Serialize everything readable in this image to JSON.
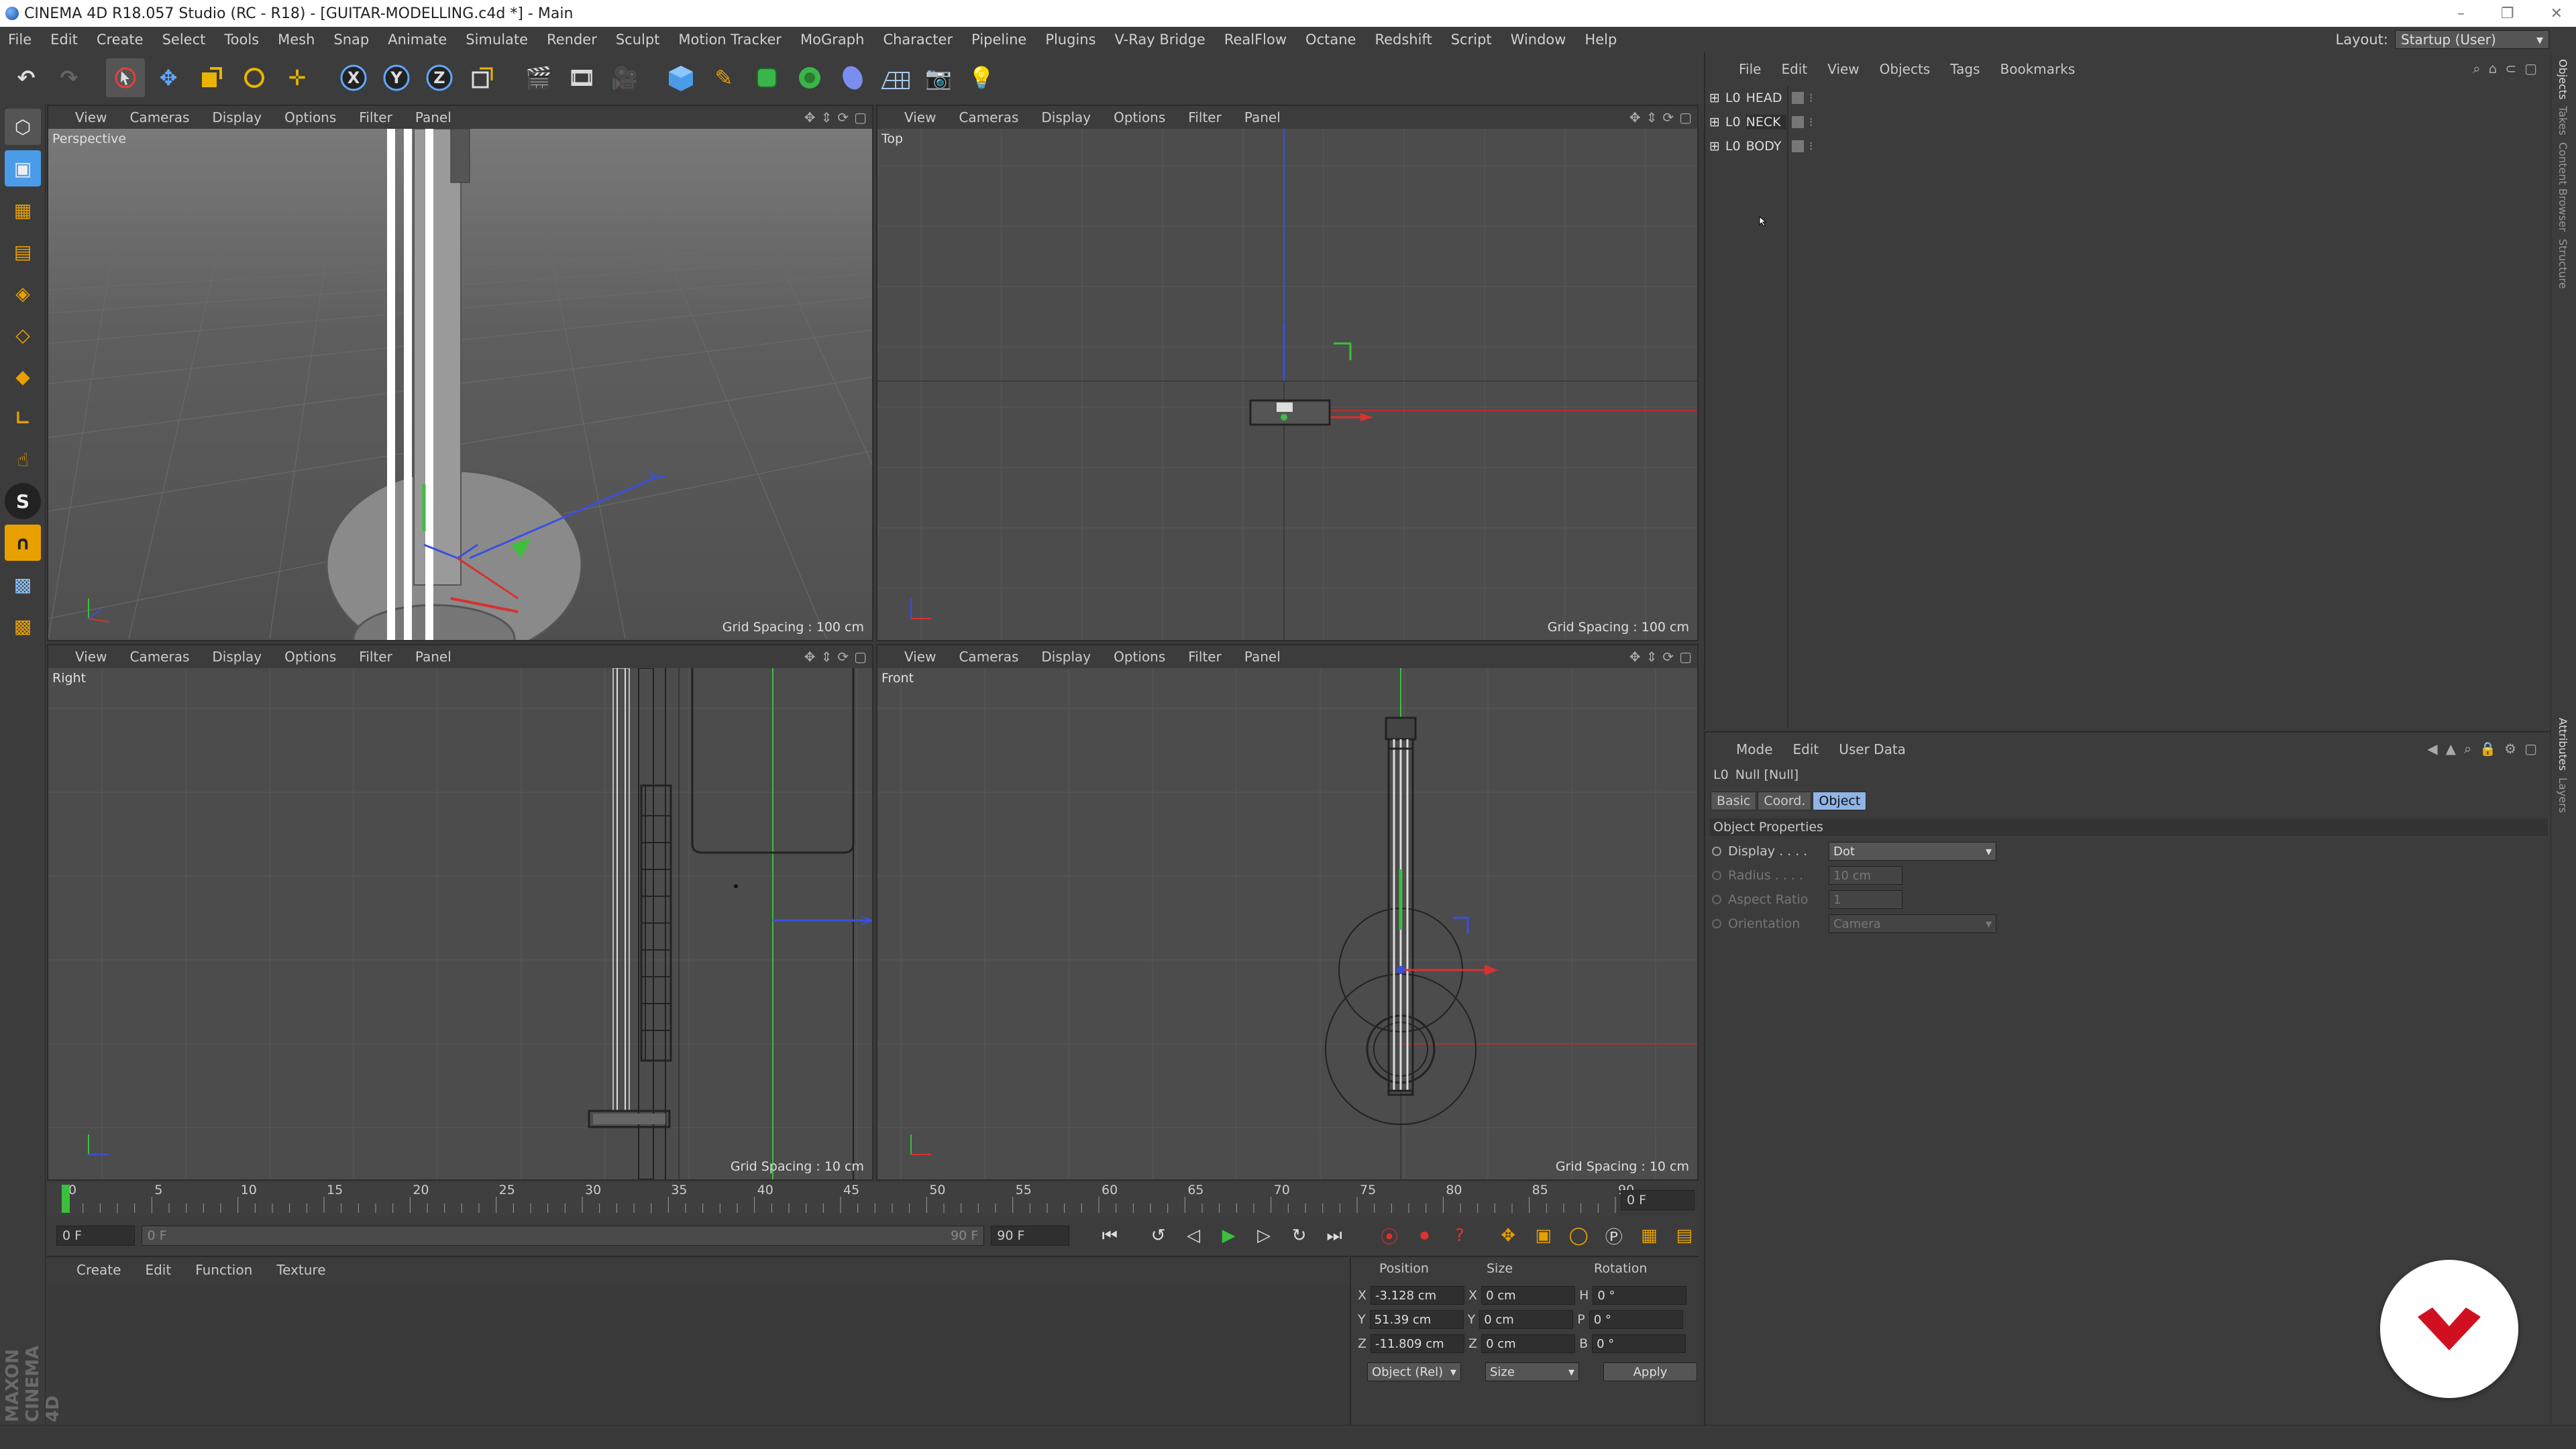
{
  "window": {
    "title": "CINEMA 4D R18.057 Studio (RC - R18) - [GUITAR-MODELLING.c4d *] - Main",
    "controls": [
      "–",
      "❐",
      "✕"
    ]
  },
  "menubar": {
    "items": [
      "File",
      "Edit",
      "Create",
      "Select",
      "Tools",
      "Mesh",
      "Snap",
      "Animate",
      "Simulate",
      "Render",
      "Sculpt",
      "Motion Tracker",
      "MoGraph",
      "Character",
      "Pipeline",
      "Plugins",
      "V-Ray Bridge",
      "RealFlow",
      "Octane",
      "Redshift",
      "Script",
      "Window",
      "Help"
    ],
    "layout_label": "Layout:",
    "layout_value": "Startup (User)"
  },
  "viewport_menu": [
    "View",
    "Cameras",
    "Display",
    "Options",
    "Filter",
    "Panel"
  ],
  "viewports": {
    "perspective": {
      "label": "Perspective",
      "grid": "Grid Spacing : 100 cm"
    },
    "top": {
      "label": "Top",
      "grid": "Grid Spacing : 100 cm"
    },
    "right": {
      "label": "Right",
      "grid": "Grid Spacing : 10 cm"
    },
    "front": {
      "label": "Front",
      "grid": "Grid Spacing : 10 cm"
    }
  },
  "timeline": {
    "ticks": [
      "0",
      "5",
      "10",
      "15",
      "20",
      "25",
      "30",
      "35",
      "40",
      "45",
      "50",
      "55",
      "60",
      "65",
      "70",
      "75",
      "80",
      "85",
      "90"
    ],
    "current_frame": "0 F",
    "start": "0 F",
    "range_start": "0 F",
    "range_end": "90 F",
    "end": "90 F"
  },
  "material_manager": {
    "menu": [
      "Create",
      "Edit",
      "Function",
      "Texture"
    ]
  },
  "coordinates": {
    "headers": [
      "Position",
      "Size",
      "Rotation"
    ],
    "rows": [
      {
        "axis": "X",
        "pos": "-3.128 cm",
        "size_axis": "X",
        "size": "0 cm",
        "rot_axis": "H",
        "rot": "0 °"
      },
      {
        "axis": "Y",
        "pos": "51.39 cm",
        "size_axis": "Y",
        "size": "0 cm",
        "rot_axis": "P",
        "rot": "0 °"
      },
      {
        "axis": "Z",
        "pos": "-11.809 cm",
        "size_axis": "Z",
        "size": "0 cm",
        "rot_axis": "B",
        "rot": "0 °"
      }
    ],
    "mode": "Object (Rel)",
    "size_mode": "Size",
    "apply": "Apply"
  },
  "object_manager": {
    "menu": [
      "File",
      "Edit",
      "View",
      "Objects",
      "Tags",
      "Bookmarks"
    ],
    "objects": [
      {
        "name": "HEAD"
      },
      {
        "name": "NECK"
      },
      {
        "name": "BODY"
      }
    ]
  },
  "attribute_manager": {
    "menu": [
      "Mode",
      "Edit",
      "User Data"
    ],
    "object_title": "Null [Null]",
    "tabs": [
      "Basic",
      "Coord.",
      "Object"
    ],
    "active_tab": "Object",
    "section": "Object Properties",
    "properties": [
      {
        "label": "Display . . . .",
        "value": "Dot",
        "enabled": true
      },
      {
        "label": "Radius . . . .",
        "value": "10 cm",
        "enabled": false
      },
      {
        "label": "Aspect Ratio",
        "value": "1",
        "enabled": false
      },
      {
        "label": "Orientation",
        "value": "Camera",
        "enabled": false
      }
    ]
  },
  "side_tabs": [
    "Objects",
    "Takes",
    "Content Browser",
    "Structure"
  ],
  "side_tabs_lower": [
    "Attributes",
    "Layers"
  ],
  "branding": {
    "logo_text": "MAXON CINEMA 4D"
  },
  "colors": {
    "accent_blue": "#8fb4e6",
    "axis_x": "#d93030",
    "axis_y": "#3cbf3c",
    "axis_z": "#3a4fe0",
    "badge_red": "#d01020"
  }
}
